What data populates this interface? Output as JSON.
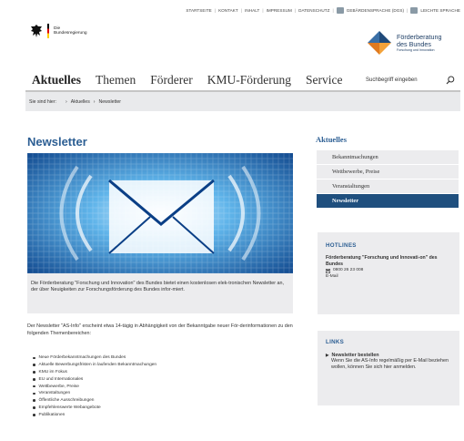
{
  "meta_nav": {
    "items": [
      "STARTSEITE",
      "KONTAKT",
      "INHALT",
      "IMPRESSUM",
      "DATENSCHUTZ",
      "GEBÄRDENSPRACHE (DGS)",
      "LEICHTE SPRACHE"
    ]
  },
  "header": {
    "bund_logo_text": [
      "Die",
      "Bundesregierung"
    ],
    "brand_title_lines": [
      "Förderberatung",
      "des Bundes"
    ],
    "brand_subtitle": "Forschung und Innovation"
  },
  "main_nav": [
    "Aktuelles",
    "Themen",
    "Förderer",
    "KMU-Förderung",
    "Service"
  ],
  "search": {
    "placeholder": "Suchbegriff eingeben"
  },
  "breadcrumb": {
    "label": "Sie sind hier:",
    "items": [
      "Aktuelles",
      "Newsletter"
    ]
  },
  "main": {
    "title": "Newsletter",
    "intro": "Die Förderberatung \"Forschung und Innovation\" des Bundes bietet einen kostenlosen elek-tronischen Newsletter an, der über Neuigkeiten zur Forschungsförderung des Bundes infor-miert.",
    "body": "Der Newsletter \"AS-Info\" erscheint etwa 14-tägig in Abhängigkeit von der Bekanntgabe neuer För-derinformationen zu den folgenden Themenbereichen:",
    "topics": [
      "Neue Förderbekanntmachungen des Bundes",
      "Aktuelle Bewerbungsfristen in laufenden Bekanntmachungen",
      "KMU im Fokus",
      "EU und Internationales",
      "Wettbewerbe, Preise",
      "Veranstaltungen",
      "Öffentliche Ausschreibungen",
      "Empfehlenswerte Webangebote",
      "Publikationen"
    ]
  },
  "sidebar": {
    "title": "Aktuelles",
    "menu": [
      {
        "label": "Bekanntmachungen",
        "active": false
      },
      {
        "label": "Wettbewerbe, Preise",
        "active": false
      },
      {
        "label": "Veranstaltungen",
        "active": false
      },
      {
        "label": "Newsletter",
        "active": true
      }
    ],
    "hotlines": {
      "heading": "HOTLINES",
      "org": "Förderberatung \"Forschung und Innovati-on\" des Bundes",
      "phone": "0800 26 23 008",
      "email_label": "E-Mail"
    },
    "links": {
      "heading": "LINKS",
      "title": "Newsletter bestellen",
      "desc": "Wenn Sie die AS-Info regelmäßig per E-Mail beziehen wollen, können Sie sich hier anmelden."
    }
  },
  "colors": {
    "accent_blue": "#2c5e93",
    "menu_active": "#1f4f7e",
    "box_gray": "#ececee"
  }
}
